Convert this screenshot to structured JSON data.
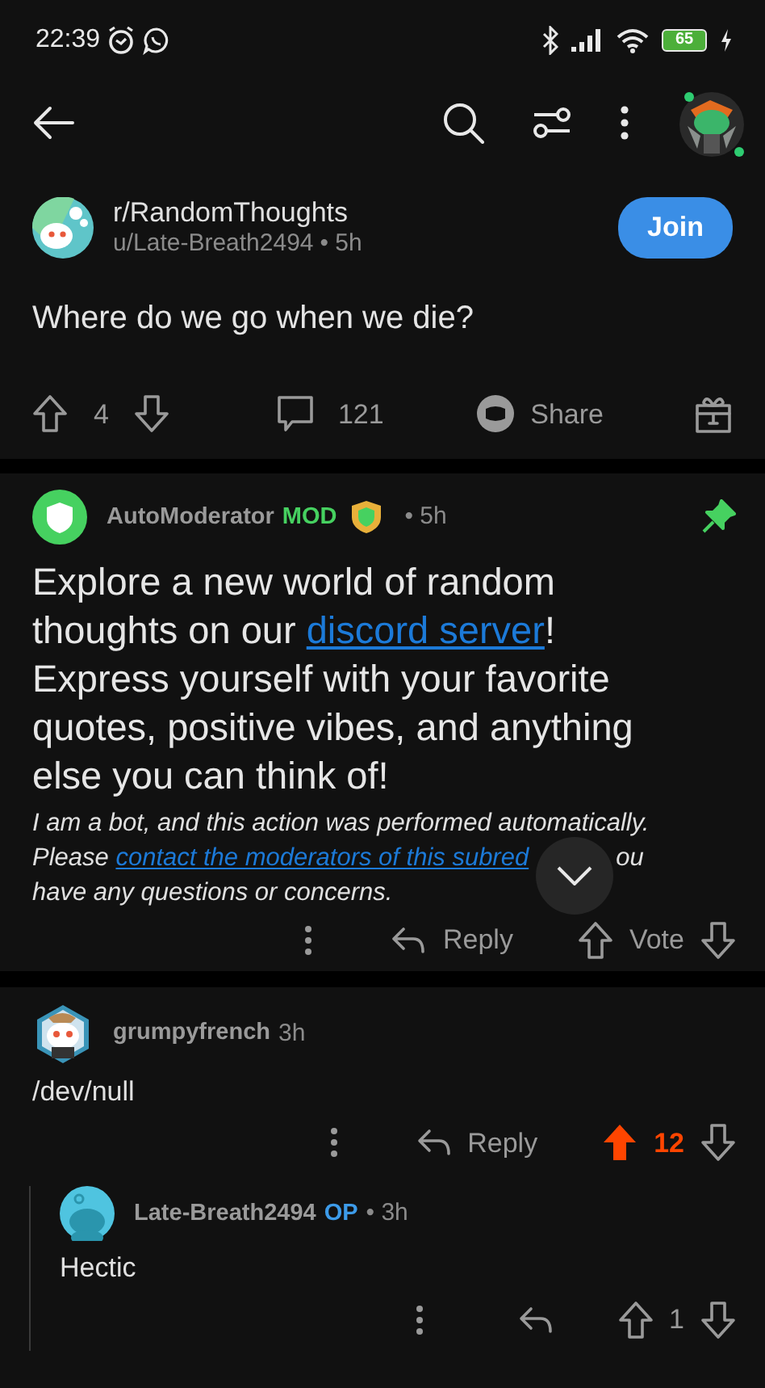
{
  "status_bar": {
    "time": "22:39",
    "battery": "65"
  },
  "post": {
    "subreddit": "r/RandomThoughts",
    "author": "u/Late-Breath2494",
    "time": "• 5h",
    "join": "Join",
    "title": "Where do we go when we die?",
    "score": "4",
    "comments": "121",
    "share": "Share"
  },
  "comments": [
    {
      "author": "AutoModerator",
      "flair": {
        "text": "MOD",
        "kind": "mod"
      },
      "award": true,
      "time": "• 5h",
      "pinned": true,
      "body": [
        {
          "kind": "heading",
          "parts": [
            {
              "kind": "text",
              "text": "Explore a new world of random thoughts on our "
            },
            {
              "kind": "link",
              "text": "discord server"
            },
            {
              "kind": "text",
              "text": "! Express yourself with your favorite quotes, positive vibes, and anything else you can think of!"
            }
          ]
        },
        {
          "kind": "note",
          "parts": [
            {
              "kind": "text",
              "text": "I am a bot, and this action was performed automatically.\nPlease "
            },
            {
              "kind": "link",
              "text": "contact the moderators of this subred"
            },
            {
              "kind": "jump_button"
            },
            {
              "kind": "text",
              "text": "ou\nhave any questions or concerns."
            }
          ]
        }
      ],
      "reply": "Reply",
      "score": "Vote",
      "upvoted": false
    },
    {
      "author": "grumpyfrench",
      "time": "3h",
      "body": [
        {
          "kind": "text",
          "parts": [
            {
              "kind": "text",
              "text": "/dev/null"
            }
          ]
        }
      ],
      "reply": "Reply",
      "score": "12",
      "upvoted": true,
      "children": [
        {
          "author": "Late-Breath2494",
          "flair": {
            "text": "OP",
            "kind": "op"
          },
          "time": "• 3h",
          "body": [
            {
              "kind": "text",
              "parts": [
                {
                  "kind": "text",
                  "text": "Hectic"
                }
              ]
            }
          ],
          "score": "1",
          "upvoted": false
        }
      ]
    }
  ]
}
